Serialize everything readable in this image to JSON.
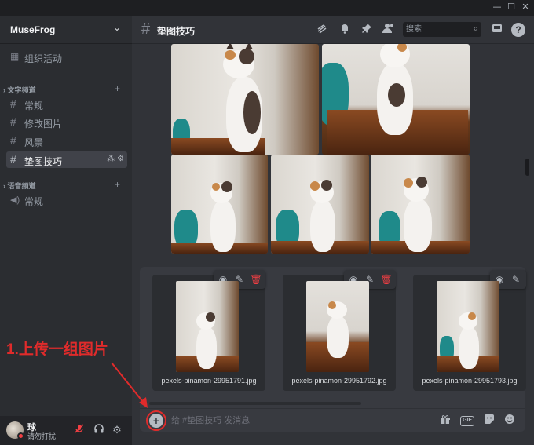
{
  "window": {
    "minimize": "—",
    "maximize": "☐",
    "close": "✕"
  },
  "server": {
    "name": "MuseFrog"
  },
  "sidebar": {
    "top_item": {
      "label": "组织活动"
    },
    "text_category": "文字频道",
    "text_channels": [
      {
        "label": "常规"
      },
      {
        "label": "修改图片"
      },
      {
        "label": "风景"
      },
      {
        "label": "垫图技巧"
      }
    ],
    "voice_category": "语音频道",
    "voice_channels": [
      {
        "label": "常规"
      }
    ]
  },
  "user": {
    "name": "球",
    "status": "请勿打扰"
  },
  "header": {
    "channel": "垫图技巧",
    "search_placeholder": "搜索"
  },
  "attachments": [
    {
      "filename": "pexels-pinamon-29951791.jpg"
    },
    {
      "filename": "pexels-pinamon-29951792.jpg"
    },
    {
      "filename": "pexels-pinamon-29951793.jpg"
    }
  ],
  "composer": {
    "placeholder": "给 #垫图技巧 发消息",
    "gif": "GIF"
  },
  "annotation": "1.上传一组图片",
  "colors": {
    "accent_red": "#e02b2b",
    "dnd": "#f23f43"
  }
}
